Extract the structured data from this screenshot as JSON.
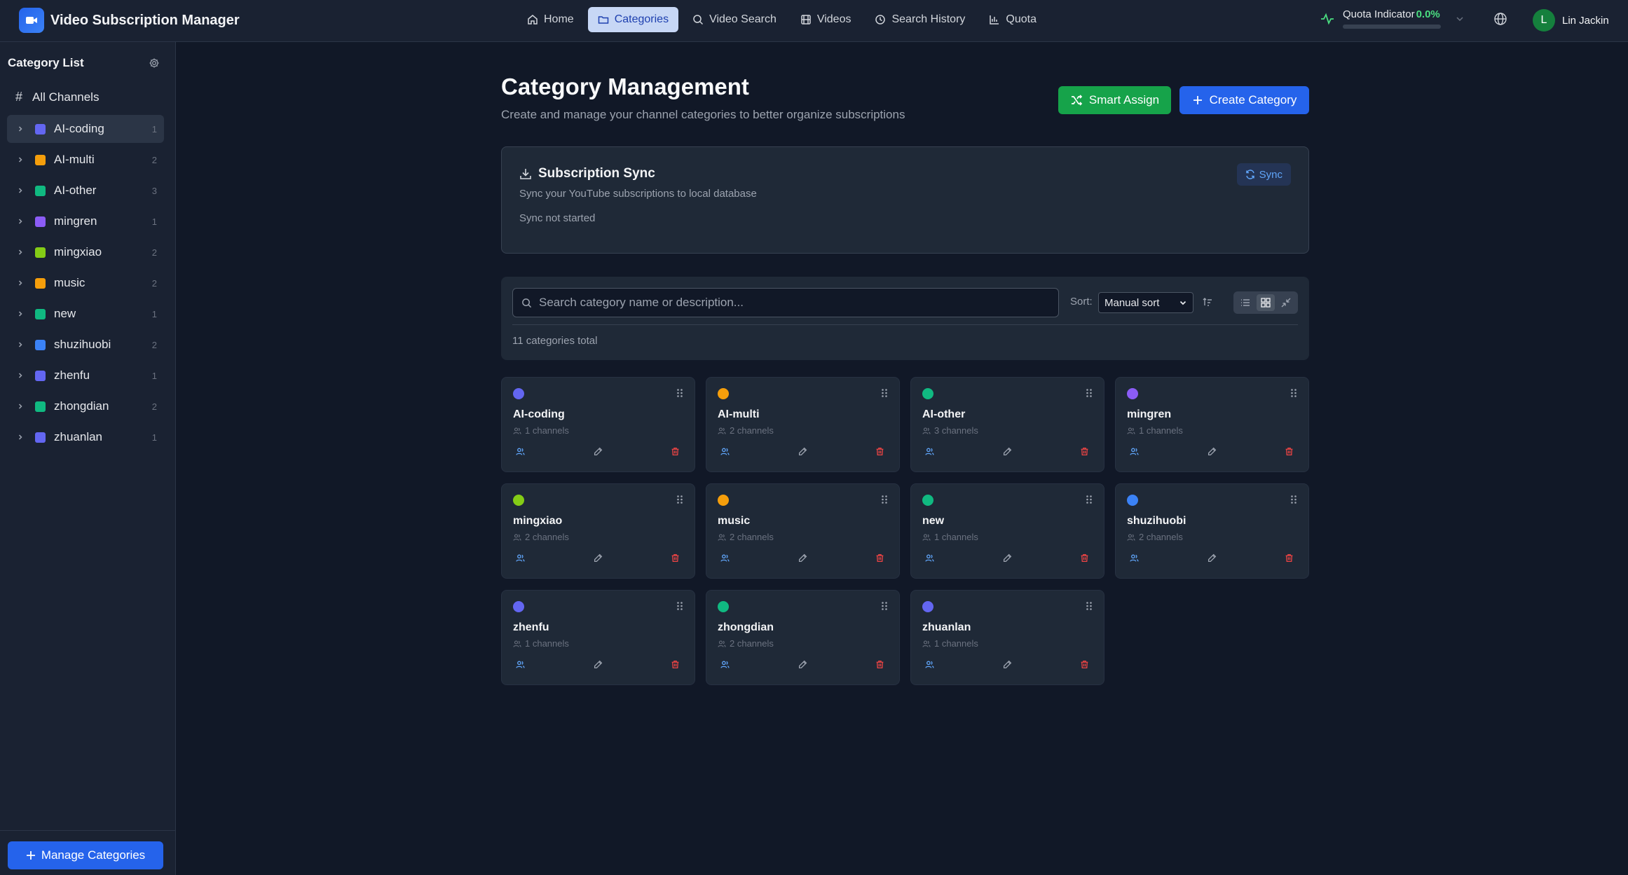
{
  "header": {
    "app_title": "Video Subscription Manager",
    "nav": [
      {
        "label": "Home",
        "icon": "home-icon",
        "active": false
      },
      {
        "label": "Categories",
        "icon": "folder-icon",
        "active": true
      },
      {
        "label": "Video Search",
        "icon": "search-icon",
        "active": false
      },
      {
        "label": "Videos",
        "icon": "film-icon",
        "active": false
      },
      {
        "label": "Search History",
        "icon": "clock-icon",
        "active": false
      },
      {
        "label": "Quota",
        "icon": "bar-chart-icon",
        "active": false
      }
    ],
    "quota_label": "Quota Indicator",
    "quota_value": "0.0%",
    "quota_fraction": 0.0,
    "user_initial": "L",
    "user_name": "Lin Jackin"
  },
  "sidebar": {
    "title": "Category List",
    "all_label": "All Channels",
    "items": [
      {
        "name": "AI-coding",
        "count": "1",
        "color": "#6366f1",
        "active": true
      },
      {
        "name": "AI-multi",
        "count": "2",
        "color": "#f59e0b",
        "active": false
      },
      {
        "name": "AI-other",
        "count": "3",
        "color": "#10b981",
        "active": false
      },
      {
        "name": "mingren",
        "count": "1",
        "color": "#8b5cf6",
        "active": false
      },
      {
        "name": "mingxiao",
        "count": "2",
        "color": "#84cc16",
        "active": false
      },
      {
        "name": "music",
        "count": "2",
        "color": "#f59e0b",
        "active": false
      },
      {
        "name": "new",
        "count": "1",
        "color": "#10b981",
        "active": false
      },
      {
        "name": "shuzihuobi",
        "count": "2",
        "color": "#3b82f6",
        "active": false
      },
      {
        "name": "zhenfu",
        "count": "1",
        "color": "#6366f1",
        "active": false
      },
      {
        "name": "zhongdian",
        "count": "2",
        "color": "#10b981",
        "active": false
      },
      {
        "name": "zhuanlan",
        "count": "1",
        "color": "#6366f1",
        "active": false
      }
    ],
    "manage_label": "Manage Categories"
  },
  "main": {
    "title": "Category Management",
    "subtitle": "Create and manage your channel categories to better organize subscriptions",
    "smart_assign_label": "Smart Assign",
    "create_label": "Create Category",
    "sync": {
      "title": "Subscription Sync",
      "subtitle": "Sync your YouTube subscriptions to local database",
      "status": "Sync not started",
      "button_label": "Sync"
    },
    "filter": {
      "search_placeholder": "Search category name or description...",
      "sort_label": "Sort:",
      "sort_value": "Manual sort",
      "total_text": "11 categories total"
    },
    "cards": [
      {
        "name": "AI-coding",
        "channels": "1 channels",
        "color": "#6366f1"
      },
      {
        "name": "AI-multi",
        "channels": "2 channels",
        "color": "#f59e0b"
      },
      {
        "name": "AI-other",
        "channels": "3 channels",
        "color": "#10b981"
      },
      {
        "name": "mingren",
        "channels": "1 channels",
        "color": "#8b5cf6"
      },
      {
        "name": "mingxiao",
        "channels": "2 channels",
        "color": "#84cc16"
      },
      {
        "name": "music",
        "channels": "2 channels",
        "color": "#f59e0b"
      },
      {
        "name": "new",
        "channels": "1 channels",
        "color": "#10b981"
      },
      {
        "name": "shuzihuobi",
        "channels": "2 channels",
        "color": "#3b82f6"
      },
      {
        "name": "zhenfu",
        "channels": "1 channels",
        "color": "#6366f1"
      },
      {
        "name": "zhongdian",
        "channels": "2 channels",
        "color": "#10b981"
      },
      {
        "name": "zhuanlan",
        "channels": "1 channels",
        "color": "#6366f1"
      }
    ]
  },
  "colors": {
    "accent": "#2563eb",
    "success": "#16a34a",
    "danger": "#ef4444",
    "background": "#111827",
    "panel": "#1f2937"
  }
}
